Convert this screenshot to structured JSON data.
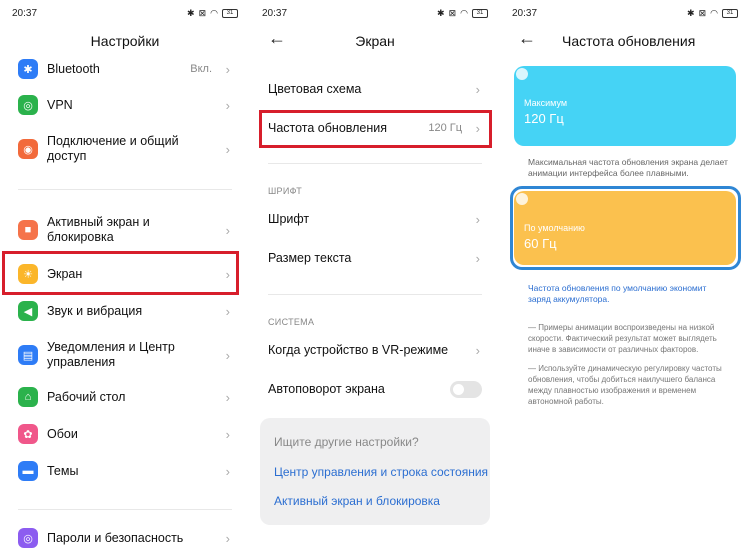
{
  "status": {
    "time": "20:37",
    "battery": "31"
  },
  "panel1": {
    "title": "Настройки",
    "items": [
      {
        "label": "Bluetooth",
        "value": "Вкл."
      },
      {
        "label": "VPN"
      },
      {
        "label": "Подключение и общий доступ"
      },
      {
        "label": "Активный экран и блокировка"
      },
      {
        "label": "Экран"
      },
      {
        "label": "Звук и вибрация"
      },
      {
        "label": "Уведомления и Центр управления"
      },
      {
        "label": "Рабочий стол"
      },
      {
        "label": "Обои"
      },
      {
        "label": "Темы"
      },
      {
        "label": "Пароли и безопасность"
      }
    ]
  },
  "panel2": {
    "title": "Экран",
    "color_scheme": "Цветовая схема",
    "refresh_rate": "Частота обновления",
    "refresh_rate_value": "120 Гц",
    "font_section": "ШРИФТ",
    "font": "Шрифт",
    "text_size": "Размер текста",
    "system_section": "СИСТЕМА",
    "vr_mode": "Когда устройство в VR-режиме",
    "autorotate": "Автоповорот экрана",
    "suggest_question": "Ищите другие настройки?",
    "suggest_link1": "Центр управления и строка состояния",
    "suggest_link2": "Активный экран и блокировка"
  },
  "panel3": {
    "title": "Частота обновления",
    "max_label": "Максимум",
    "max_value": "120 Гц",
    "max_desc": "Максимальная частота обновления экрана делает анимации интерфейса более плавными.",
    "default_label": "По умолчанию",
    "default_value": "60 Гц",
    "default_desc": "Частота обновления по умолчанию экономит заряд аккумулятора.",
    "note1": "— Примеры анимации воспроизведены на низкой скорости. Фактический результат может выглядеть иначе в зависимости от различных факторов.",
    "note2": "— Используйте динамическую регулировку частоты обновления, чтобы добиться наилучшего баланса между плавностью изображения и временем автономной работы."
  },
  "colors": {
    "highlight": "#d71e2b",
    "max_card": "#45d3f5",
    "default_card": "#fbc14e",
    "selected_border": "#2f86d4",
    "link": "#2b6ed1"
  },
  "icons": {
    "bluetooth": "bluetooth-icon",
    "vpn": "vpn-icon",
    "connection": "connection-icon",
    "lock": "lock-icon",
    "display": "sun-icon",
    "sound": "speaker-icon",
    "notifications": "notifications-icon",
    "desktop": "home-icon",
    "wallpaper": "flower-icon",
    "themes": "brush-icon",
    "password": "fingerprint-icon"
  }
}
